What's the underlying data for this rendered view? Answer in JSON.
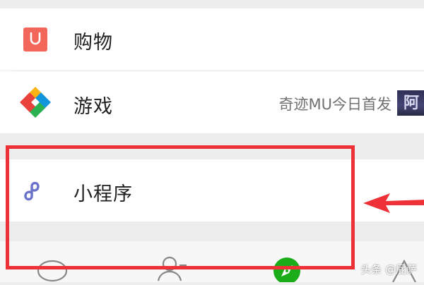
{
  "menu": {
    "shopping": {
      "label": "购物",
      "icon": "shopping-bag-icon",
      "icon_color": "#f2675a"
    },
    "games": {
      "label": "游戏",
      "icon": "games-icon",
      "description": "奇迹MU今日首发",
      "thumb_text": "阿"
    },
    "mini_programs": {
      "label": "小程序",
      "icon": "mini-program-icon",
      "icon_color": "#6a73c9"
    }
  },
  "annotation": {
    "box_color": "#ee3137",
    "arrow_color": "#ee3137"
  },
  "tabbar": {
    "tabs": [
      {
        "icon": "chat-bubble-icon"
      },
      {
        "icon": "contacts-icon"
      },
      {
        "icon": "discover-compass-icon",
        "active_color": "#1aad19"
      },
      {
        "icon": "me-person-icon"
      }
    ]
  },
  "watermark": "头条 @屁萨"
}
